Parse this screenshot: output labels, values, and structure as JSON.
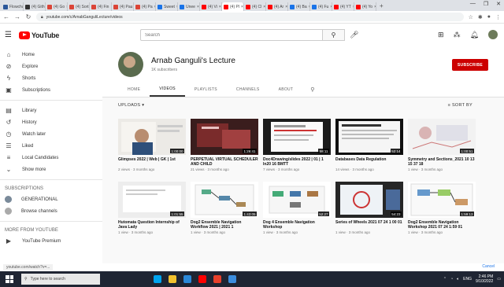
{
  "browser": {
    "tabs": [
      {
        "label": "Flowchart",
        "color": "#2b579a"
      },
      {
        "label": "(4) Gith",
        "color": "#333333"
      },
      {
        "label": "(4) Go",
        "color": "#db4437"
      },
      {
        "label": "(4) Sort",
        "color": "#db4437"
      },
      {
        "label": "(4) Fin",
        "color": "#db4437"
      },
      {
        "label": "(4) Pau",
        "color": "#db4437"
      },
      {
        "label": "(4) Pa",
        "color": "#db4437"
      },
      {
        "label": "Sweet",
        "color": "#1a73e8"
      },
      {
        "label": "Unee",
        "color": "#1a73e8"
      },
      {
        "label": "(4) Vi",
        "color": "#ff0000"
      },
      {
        "label": "(4) Pl",
        "color": "#ff0000"
      },
      {
        "label": "(4) Cl",
        "color": "#ff0000"
      },
      {
        "label": "(4) Ar",
        "color": "#ff0000"
      },
      {
        "label": "(4) Ba",
        "color": "#1a73e8"
      },
      {
        "label": "(4) Fu",
        "color": "#1a73e8"
      },
      {
        "label": "(4) YT",
        "color": "#ff0000"
      },
      {
        "label": "(4) Yo",
        "color": "#ff0000"
      }
    ],
    "new_tab": "+",
    "window_controls": [
      "—",
      "❐",
      "✕"
    ],
    "url": "youtube.com/c/ArnabGanguliLecture/videos"
  },
  "youtube": {
    "logo_text": "YouTube",
    "search_placeholder": "Search",
    "sidebar": {
      "main": [
        {
          "label": "Home",
          "icon": "home-icon",
          "glyph": "⌂"
        },
        {
          "label": "Explore",
          "icon": "compass-icon",
          "glyph": "⊘"
        },
        {
          "label": "Shorts",
          "icon": "shorts-icon",
          "glyph": "ϟ"
        },
        {
          "label": "Subscriptions",
          "icon": "subscriptions-icon",
          "glyph": "▣"
        }
      ],
      "library": [
        {
          "label": "Library",
          "icon": "library-icon",
          "glyph": "▤"
        },
        {
          "label": "History",
          "icon": "history-icon",
          "glyph": "↺"
        },
        {
          "label": "Watch later",
          "icon": "clock-icon",
          "glyph": "◷"
        },
        {
          "label": "Liked",
          "icon": "like-icon",
          "glyph": "☰"
        },
        {
          "label": "Local Candidates",
          "icon": "playlist-icon",
          "glyph": "≡"
        },
        {
          "label": "Show more",
          "icon": "chevron-down-icon",
          "glyph": "⌄"
        }
      ],
      "subscriptions_heading": "SUBSCRIPTIONS",
      "subscriptions": [
        {
          "label": "GENERATIONAL",
          "color": "#7a8a9a"
        },
        {
          "label": "Browse channels",
          "color": "#aaaaaa"
        }
      ],
      "more_heading": "MORE FROM YOUTUBE",
      "more": [
        {
          "label": "YouTube Premium",
          "icon": "youtube-icon",
          "glyph": "▶"
        }
      ]
    },
    "channel": {
      "name": "Arnab Ganguli's Lecture",
      "subscribers": "1K subscribers",
      "subscribe_label": "SUBSCRIBE",
      "tabs": [
        "HOME",
        "VIDEOS",
        "PLAYLISTS",
        "CHANNELS",
        "ABOUT"
      ],
      "active_tab": "VIDEOS"
    },
    "uploads_label": "UPLOADS ▾",
    "sort_label": "≡  SORT BY",
    "videos": [
      {
        "title": "Glimpses 2022 | Web | GK | 1st",
        "meta": "2 views · 3 months ago",
        "duration": "1:00:00",
        "theme": "person"
      },
      {
        "title": "PERPETUAL VIRTUAL SCHEDULER AND CHILD",
        "meta": "21 views · 3 months ago",
        "duration": "1:26:41",
        "theme": "dark"
      },
      {
        "title": "Doc4Drawing/slides 2022 | 01 | 1 ln20 16 BMTT",
        "meta": "7 views · 3 months ago",
        "duration": "58:11",
        "theme": "slide"
      },
      {
        "title": "Databases Data Regulation",
        "meta": "14 views · 3 months ago",
        "duration": "52:14",
        "theme": "slide2"
      },
      {
        "title": "Symmetry and Sections_2021 10 13 15 37 18",
        "meta": "1 view · 3 months ago",
        "duration": "1:00:51",
        "theme": "light"
      },
      {
        "title": "Hutomata Question Internship of Java Lady",
        "meta": "1 view · 3 months ago",
        "duration": "1:01:55",
        "theme": "white"
      },
      {
        "title": "Dog2 Ensemble Navigation Workflow 2021 | 2021 1",
        "meta": "1 view · 3 months ago",
        "duration": "1:43:05",
        "theme": "diagram"
      },
      {
        "title": "Dog 4 Ensemble Navigation Workshop",
        "meta": "1 view · 3 months ago",
        "duration": "52:27",
        "theme": "diagram2"
      },
      {
        "title": "Series of Wheels 2021 07 24 1 00 01",
        "meta": "1 view · 3 months ago",
        "duration": "54:23",
        "theme": "dark2"
      },
      {
        "title": "Dog2 Ensemble Navigation Workshop 2021 07 24 1:59 01",
        "meta": "1 view · 3 months ago",
        "duration": "1:59:13",
        "theme": "diagram3"
      }
    ],
    "status_tip": "youtube.com/watch?v=...",
    "cancel_label": "Cancel"
  },
  "taskbar": {
    "search_placeholder": "Type here to search",
    "apps": [
      "#00a4ef",
      "#f2c12e",
      "#2b88d8",
      "#ff0000",
      "#e8412c",
      "#3c8dde"
    ],
    "time": "2:46 PM",
    "date": "9/10/2022",
    "tray_text": "ENG"
  }
}
